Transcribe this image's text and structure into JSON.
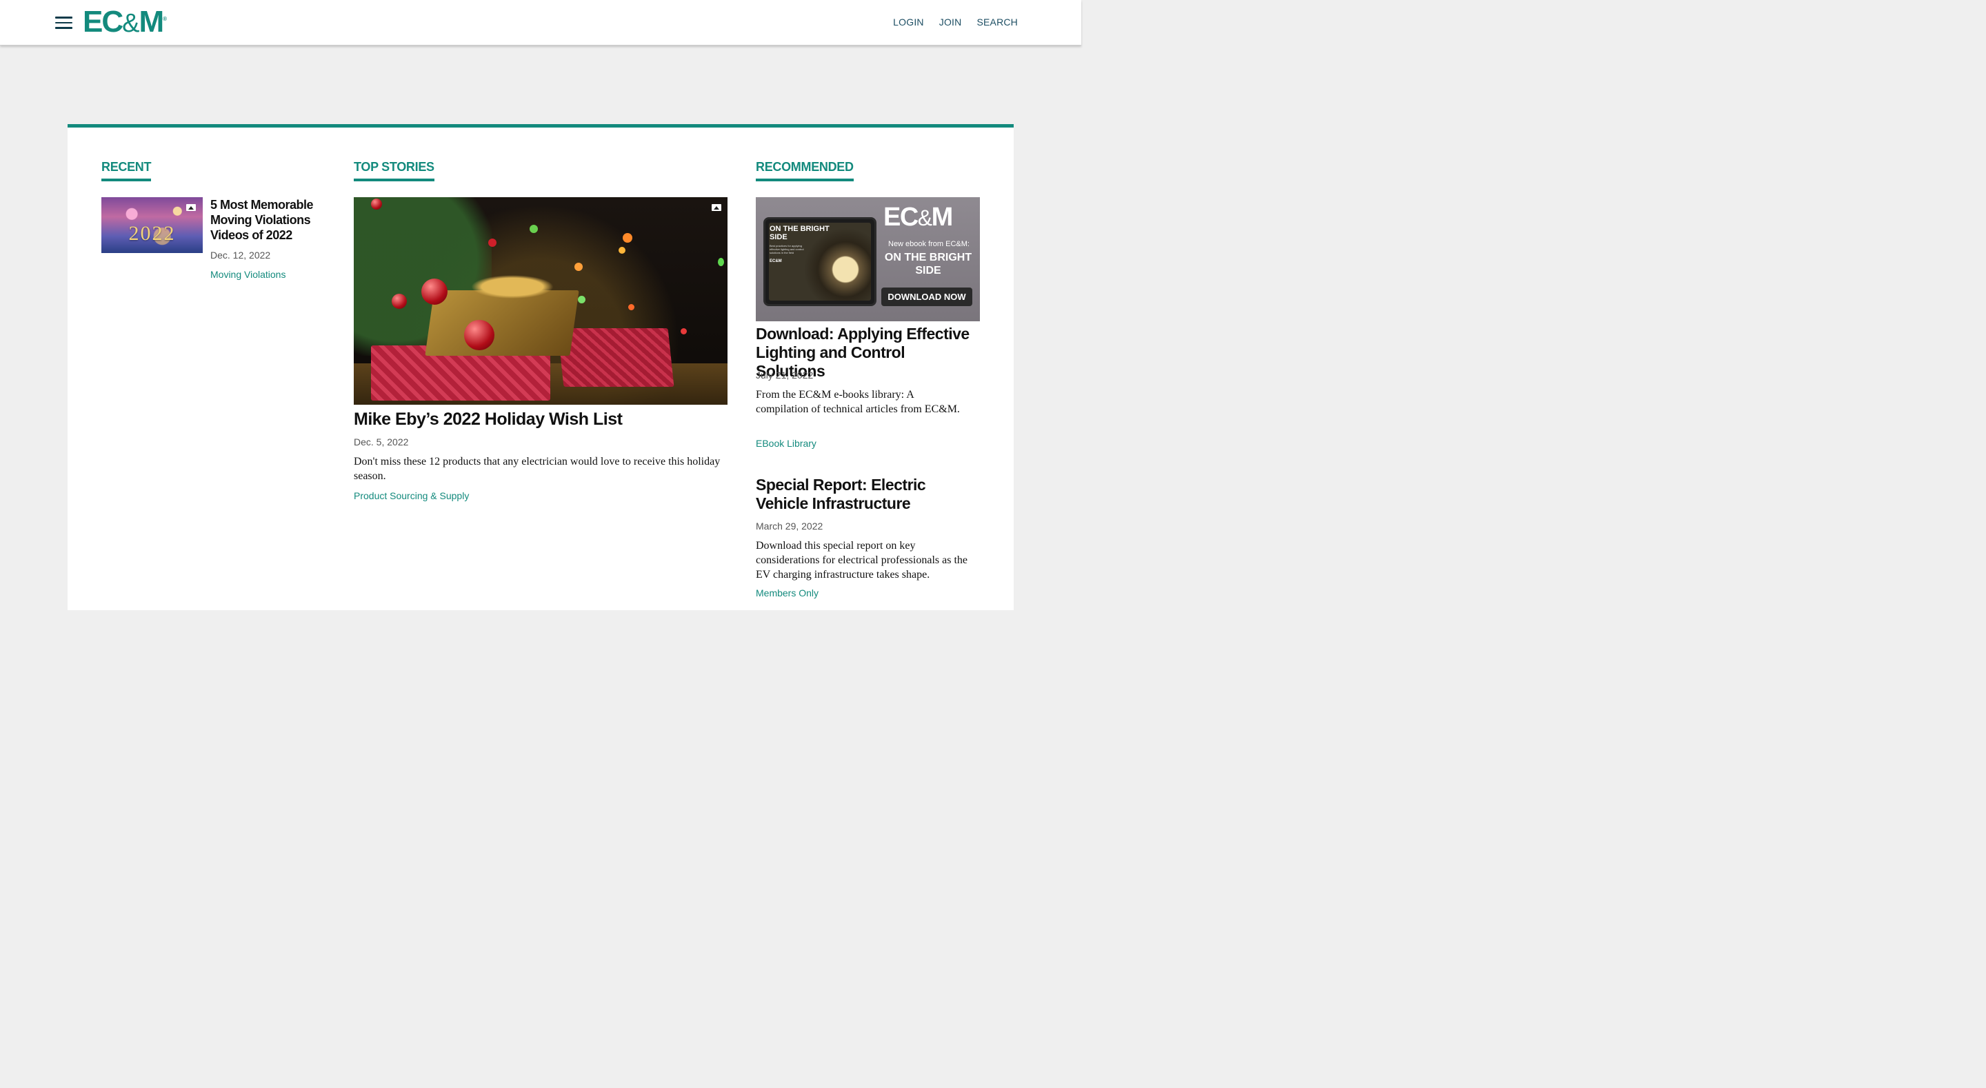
{
  "header": {
    "logo": {
      "main": "EC",
      "amp": "&",
      "end": "M",
      "reg": "®"
    },
    "nav": [
      "LOGIN",
      "JOIN",
      "SEARCH"
    ]
  },
  "sections": {
    "recent": {
      "title": "RECENT",
      "items": [
        {
          "thumb_text": "2022",
          "headline": "5 Most Memorable Moving Violations Videos of 2022",
          "date": "Dec. 12, 2022",
          "tag": "Moving Violations"
        }
      ]
    },
    "top_stories": {
      "title": "TOP STORIES",
      "items": [
        {
          "headline": "Mike Eby’s 2022 Holiday Wish List",
          "date": "Dec. 5, 2022",
          "summary": "Don't miss these 12 products that any electrician would love to receive this holiday season.",
          "tag": "Product Sourcing & Supply"
        }
      ]
    },
    "recommended": {
      "title": "RECOMMENDED",
      "banner": {
        "tablet_title": "ON THE BRIGHT SIDE",
        "tablet_sub": "Best practices for applying effective lighting and control solutions in the field",
        "tablet_logo": "EC&M",
        "logo_main": "EC",
        "logo_amp": "&",
        "logo_end": "M",
        "small": "New ebook from EC&M:",
        "big": "ON THE BRIGHT SIDE",
        "button": "DOWNLOAD NOW"
      },
      "items": [
        {
          "headline": "Download: Applying Effective Lighting and Control Solutions",
          "date": "July 21, 2022",
          "summary": "From the EC&M e-books library: A compilation of technical articles from EC&M.",
          "tag": "EBook Library"
        },
        {
          "headline": "Special Report: Electric Vehicle Infrastructure",
          "date": "March 29, 2022",
          "summary": "Download this special report on key considerations for electrical professionals as the EV charging infrastructure takes shape.",
          "tag": "Members Only"
        }
      ]
    }
  },
  "colors": {
    "accent": "#138a7d",
    "nav_text": "#1d4e63"
  }
}
